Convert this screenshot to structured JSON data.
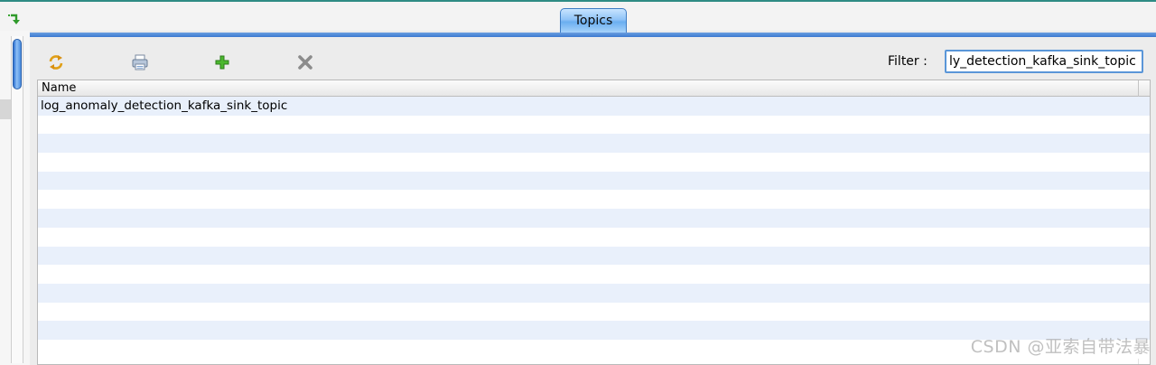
{
  "tabs": [
    {
      "label": "Topics"
    }
  ],
  "toolbar": {
    "buttons": [
      {
        "name": "refresh",
        "icon": "refresh-icon"
      },
      {
        "name": "print",
        "icon": "printer-icon"
      },
      {
        "name": "add",
        "icon": "plus-icon"
      },
      {
        "name": "delete",
        "icon": "x-icon"
      }
    ],
    "filter_label": "Filter :",
    "filter_value": "ly_detection_kafka_sink_topic"
  },
  "table": {
    "columns": [
      "Name"
    ],
    "rows": [
      {
        "name": "log_anomaly_detection_kafka_sink_topic"
      },
      {
        "name": ""
      },
      {
        "name": ""
      },
      {
        "name": ""
      },
      {
        "name": ""
      },
      {
        "name": ""
      },
      {
        "name": ""
      },
      {
        "name": ""
      },
      {
        "name": ""
      },
      {
        "name": ""
      },
      {
        "name": ""
      },
      {
        "name": ""
      },
      {
        "name": ""
      },
      {
        "name": ""
      }
    ]
  },
  "watermark": "CSDN @亚索自带法暴",
  "colors": {
    "tab_active": "#8fc3f7",
    "row_alt": "#e9f0fb",
    "panel_border": "#3b78d0"
  }
}
